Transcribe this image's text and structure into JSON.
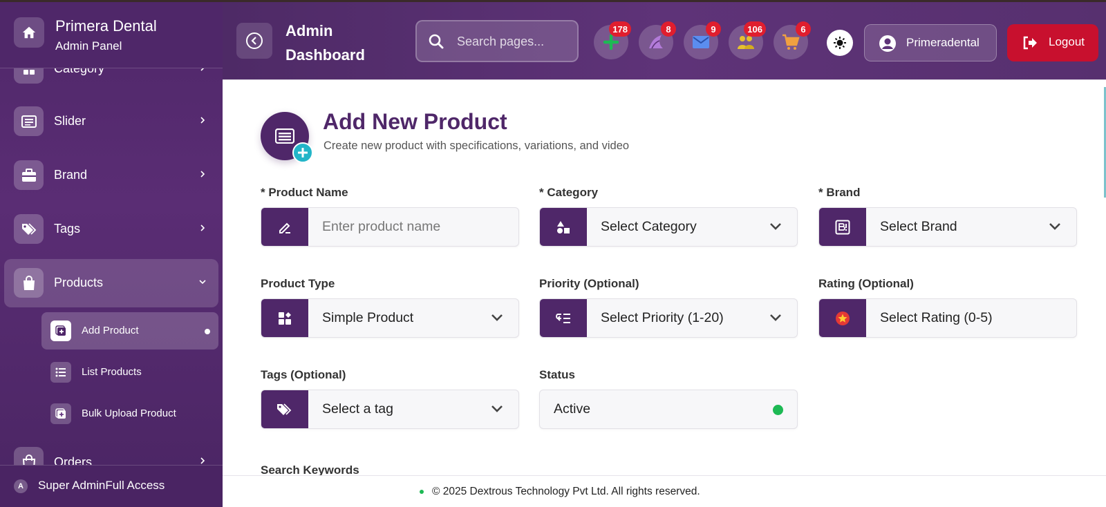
{
  "brand": {
    "name": "Primera Dental",
    "subtitle": "Admin Panel"
  },
  "sidebar": {
    "items": [
      {
        "label": "Category",
        "icon": "category-icon"
      },
      {
        "label": "Slider",
        "icon": "slider-icon"
      },
      {
        "label": "Brand",
        "icon": "briefcase-icon"
      },
      {
        "label": "Tags",
        "icon": "tags-icon"
      },
      {
        "label": "Products",
        "icon": "shopping-bag-icon",
        "expanded": true
      },
      {
        "label": "Orders",
        "icon": "orders-icon"
      }
    ],
    "sub_items": [
      {
        "label": "Add Product",
        "icon": "add-square-icon",
        "active": true
      },
      {
        "label": "List Products",
        "icon": "list-icon"
      },
      {
        "label": "Bulk Upload Product",
        "icon": "add-square-icon"
      }
    ],
    "footer": {
      "avatar": "A",
      "text": "Super AdminFull Access"
    }
  },
  "header": {
    "title": "Admin Dashboard",
    "search_placeholder": "Search pages...",
    "icons": [
      {
        "name": "plus-icon",
        "badge": "178",
        "color": "#1db954"
      },
      {
        "name": "shark-icon",
        "badge": "8",
        "color": "#b27bd8"
      },
      {
        "name": "mail-icon",
        "badge": "9",
        "color": "#5b8def"
      },
      {
        "name": "users-icon",
        "badge": "106",
        "color": "#e6c12e"
      },
      {
        "name": "cart-icon",
        "badge": "6",
        "color": "#f0a040"
      }
    ],
    "user": "Primeradental",
    "logout": "Logout"
  },
  "page": {
    "title": "Add New Product",
    "subtitle": "Create new product with specifications, variations, and video"
  },
  "form": {
    "product_name": {
      "label": "* Product Name",
      "placeholder": "Enter product name"
    },
    "category": {
      "label": "* Category",
      "value": "Select Category"
    },
    "brand": {
      "label": "* Brand",
      "value": "Select Brand"
    },
    "product_type": {
      "label": "Product Type",
      "value": "Simple Product"
    },
    "priority": {
      "label": "Priority (Optional)",
      "value": "Select Priority (1-20)"
    },
    "rating": {
      "label": "Rating (Optional)",
      "value": "Select Rating (0-5)"
    },
    "tags": {
      "label": "Tags (Optional)",
      "value": "Select a tag"
    },
    "status": {
      "label": "Status",
      "value": "Active"
    },
    "search_keywords": {
      "label": "Search Keywords"
    }
  },
  "footer": {
    "text": "© 2025 Dextrous Technology Pvt Ltd. All rights reserved."
  },
  "colors": {
    "primary": "#4f2769",
    "accent": "#23b5c8",
    "danger": "#c8102e",
    "success": "#1db954"
  }
}
